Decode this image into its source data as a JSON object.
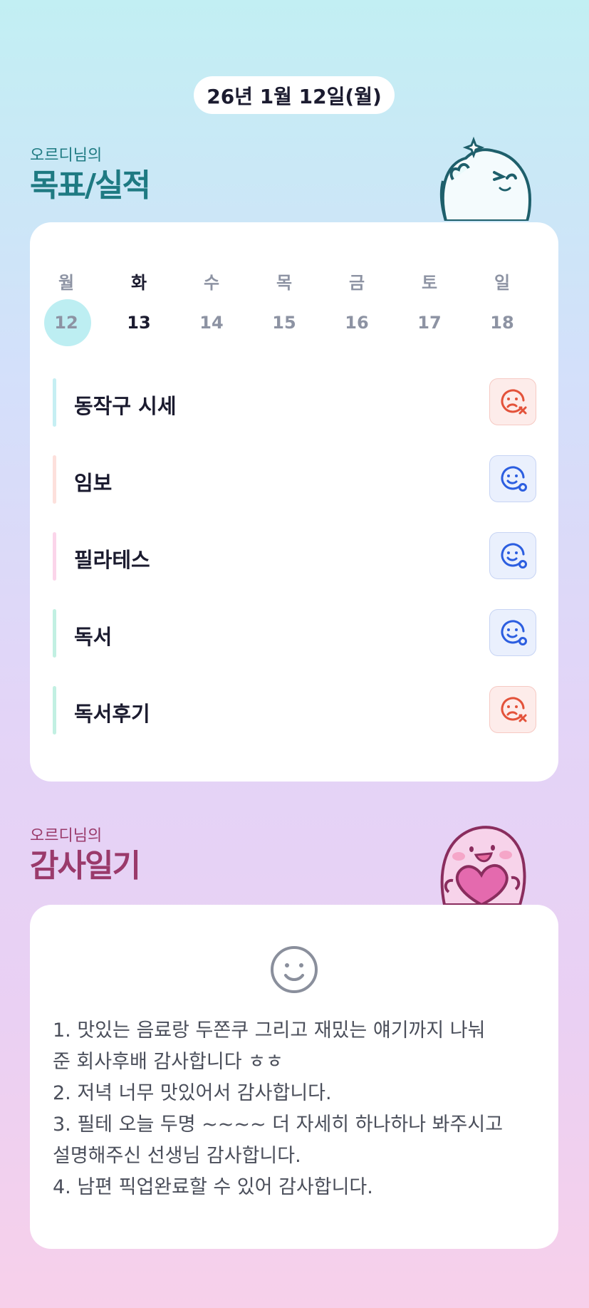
{
  "header": {
    "date": "26년 1월 12일(월)"
  },
  "goals_section": {
    "subtitle": "오르디님의",
    "title": "목표/실적"
  },
  "week": {
    "days": [
      "월",
      "화",
      "수",
      "목",
      "금",
      "토",
      "일"
    ],
    "dates": [
      "12",
      "13",
      "14",
      "15",
      "16",
      "17",
      "18"
    ]
  },
  "goals": [
    {
      "name": "동작구 시세",
      "status": "fail",
      "bar_color": "#c6eff3"
    },
    {
      "name": "임보",
      "status": "ok",
      "bar_color": "#fde0dc"
    },
    {
      "name": "필라테스",
      "status": "ok",
      "bar_color": "#fbd5ea"
    },
    {
      "name": "독서",
      "status": "ok",
      "bar_color": "#c2f0e2"
    },
    {
      "name": "독서후기",
      "status": "fail",
      "bar_color": "#c2f0e2"
    }
  ],
  "status_colors": {
    "fail": "#e3523a",
    "ok": "#2c5ee0"
  },
  "gratitude_section": {
    "subtitle": "오르디님의",
    "title": "감사일기"
  },
  "gratitude": {
    "mood_icon": "smile-icon",
    "lines": [
      "1. 맛있는 음료랑 두쫀쿠 그리고 재밌는 얘기까지 나눠",
      "준 회사후배 감사합니다 ㅎㅎ",
      "2. 저녁 너무 맛있어서 감사합니다.",
      "3. 필테 오늘 두명 ~~~~ 더 자세히 하나하나 봐주시고",
      "설명해주신 선생님 감사합니다.",
      "4. 남편 픽업완료할 수 있어 감사합니다."
    ]
  }
}
